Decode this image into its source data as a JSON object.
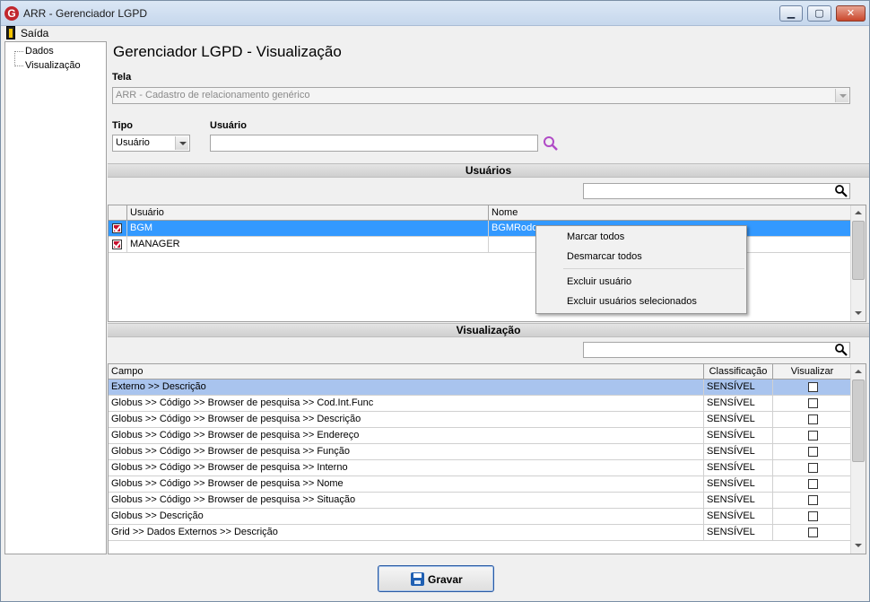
{
  "window": {
    "title": "ARR - Gerenciador LGPD",
    "logo_letter": "G",
    "min_glyph": "▁",
    "max_glyph": "▢",
    "close_glyph": "✕"
  },
  "menu": {
    "exit_label": "Saída"
  },
  "tree": {
    "items": [
      "Dados",
      "Visualização"
    ]
  },
  "page_title": "Gerenciador LGPD - Visualização",
  "tela": {
    "label": "Tela",
    "value": "ARR - Cadastro de relacionamento genérico"
  },
  "tipo": {
    "label": "Tipo",
    "value": "Usuário"
  },
  "usuario_field": {
    "label": "Usuário",
    "value": ""
  },
  "usuarios_section": {
    "title": "Usuários",
    "search_value": "",
    "columns": [
      "Usuário",
      "Nome"
    ],
    "rows": [
      {
        "usuario": "BGM",
        "nome": "BGMRodo",
        "checked": true
      },
      {
        "usuario": "MANAGER",
        "nome": "",
        "checked": true
      }
    ]
  },
  "context_menu": {
    "items": [
      "Marcar todos",
      "Desmarcar todos",
      "Excluir usuário",
      "Excluir usuários selecionados"
    ]
  },
  "visualizacao_section": {
    "title": "Visualização",
    "search_value": "",
    "columns": [
      "Campo",
      "Classificação",
      "Visualizar"
    ],
    "rows": [
      {
        "campo": "Externo >> Descrição",
        "classificacao": "SENSÍVEL",
        "visualizar": false
      },
      {
        "campo": "Globus >> Código >> Browser de pesquisa >> Cod.Int.Func",
        "classificacao": "SENSÍVEL",
        "visualizar": false
      },
      {
        "campo": "Globus >> Código >> Browser de pesquisa >> Descrição",
        "classificacao": "SENSÍVEL",
        "visualizar": false
      },
      {
        "campo": "Globus >> Código >> Browser de pesquisa >> Endereço",
        "classificacao": "SENSÍVEL",
        "visualizar": false
      },
      {
        "campo": "Globus >> Código >> Browser de pesquisa >> Função",
        "classificacao": "SENSÍVEL",
        "visualizar": false
      },
      {
        "campo": "Globus >> Código >> Browser de pesquisa >> Interno",
        "classificacao": "SENSÍVEL",
        "visualizar": false
      },
      {
        "campo": "Globus >> Código >> Browser de pesquisa >> Nome",
        "classificacao": "SENSÍVEL",
        "visualizar": false
      },
      {
        "campo": "Globus >> Código >> Browser de pesquisa >> Situação",
        "classificacao": "SENSÍVEL",
        "visualizar": false
      },
      {
        "campo": "Globus >> Descrição",
        "classificacao": "SENSÍVEL",
        "visualizar": false
      },
      {
        "campo": "Grid >> Dados Externos >>  Descrição",
        "classificacao": "SENSÍVEL",
        "visualizar": false
      }
    ]
  },
  "footer": {
    "save_label": "Gravar"
  },
  "colors": {
    "selection": "#3399ff",
    "selection_light": "#a9c4ee",
    "accent_search": "#b04ac6",
    "check_red": "#c8102e",
    "save_blue": "#1f5fb2"
  }
}
